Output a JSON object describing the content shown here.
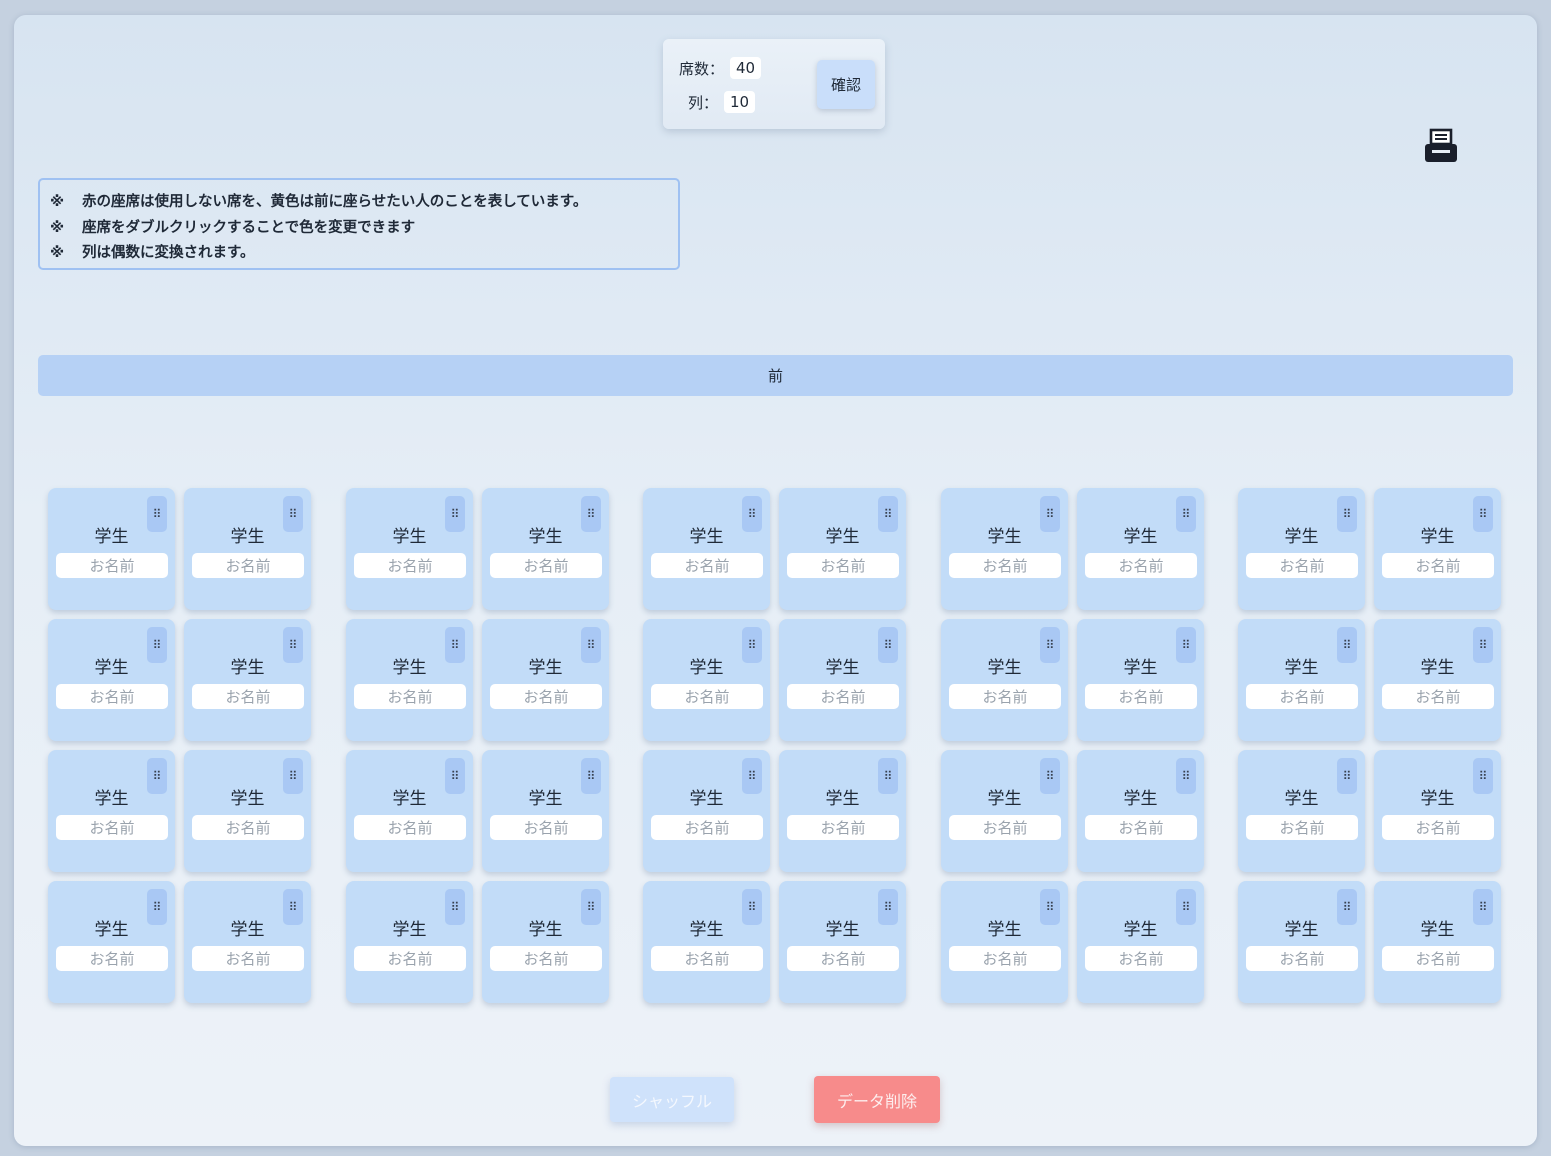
{
  "config": {
    "seats_label": "席数：",
    "seats_value": "40",
    "columns_label": "列：",
    "columns_value": "10",
    "confirm_label": "確認"
  },
  "toolbar": {
    "print_icon": "printer-icon"
  },
  "notes": [
    {
      "mark": "※",
      "text": "赤の座席は使用しない席を、黄色は前に座らせたい人のことを表しています。"
    },
    {
      "mark": "※",
      "text": "座席をダブルクリックすることで色を変更できます"
    },
    {
      "mark": "※",
      "text": "列は偶数に変換されます。"
    }
  ],
  "front_label": "前",
  "seat": {
    "label": "学生",
    "name_placeholder": "お名前",
    "handle_icon": "drag-handle-icon",
    "handle_glyph": "⠿"
  },
  "layout": {
    "rows": 4,
    "pairs": 5,
    "seats_per_pair": 2
  },
  "actions": {
    "shuffle_label": "シャッフル",
    "delete_label": "データ削除"
  },
  "colors": {
    "seat_bg": "#c2dcf8",
    "front_bar": "#b6d1f5",
    "delete_button": "#f78b8b",
    "shuffle_button": "#cfe2fb"
  }
}
